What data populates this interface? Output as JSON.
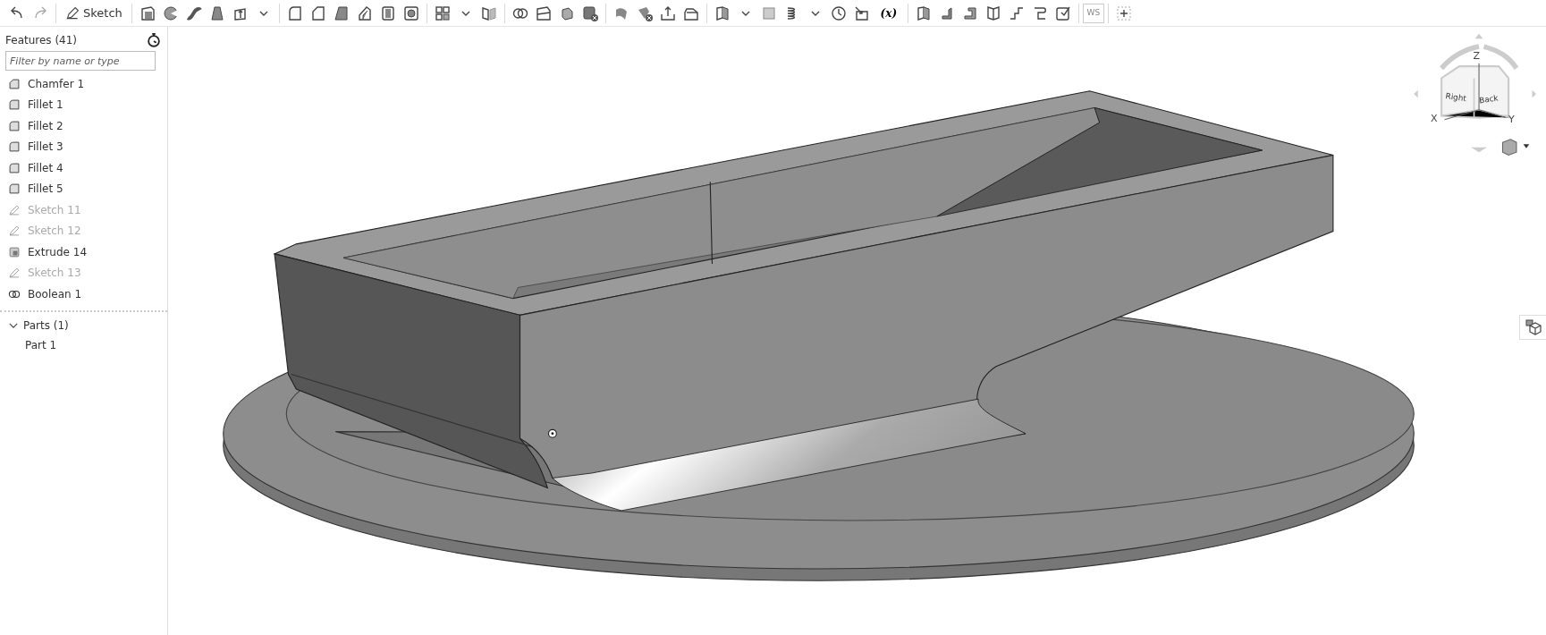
{
  "toolbar": {
    "sketch_label": "Sketch",
    "variable_label": "(x)",
    "workspace_label": "WS"
  },
  "features": {
    "title": "Features (41)",
    "filter": {
      "placeholder": "Filter by name or type"
    },
    "items": [
      {
        "label": "Chamfer 1",
        "kind": "chamfer",
        "hidden": false
      },
      {
        "label": "Fillet 1",
        "kind": "fillet",
        "hidden": false
      },
      {
        "label": "Fillet 2",
        "kind": "fillet",
        "hidden": false
      },
      {
        "label": "Fillet 3",
        "kind": "fillet",
        "hidden": false
      },
      {
        "label": "Fillet 4",
        "kind": "fillet",
        "hidden": false
      },
      {
        "label": "Fillet 5",
        "kind": "fillet",
        "hidden": false
      },
      {
        "label": "Sketch 11",
        "kind": "sketch",
        "hidden": true
      },
      {
        "label": "Sketch 12",
        "kind": "sketch",
        "hidden": true
      },
      {
        "label": "Extrude 14",
        "kind": "extrude",
        "hidden": false
      },
      {
        "label": "Sketch 13",
        "kind": "sketch",
        "hidden": true
      },
      {
        "label": "Boolean 1",
        "kind": "boolean",
        "hidden": false
      }
    ]
  },
  "parts": {
    "title": "Parts (1)",
    "expanded": true,
    "children": [
      {
        "label": "Part 1"
      }
    ]
  },
  "view_cube": {
    "axis_z": "Z",
    "axis_x": "X",
    "axis_y": "Y",
    "face_right": "Right",
    "face_back": "Back"
  }
}
